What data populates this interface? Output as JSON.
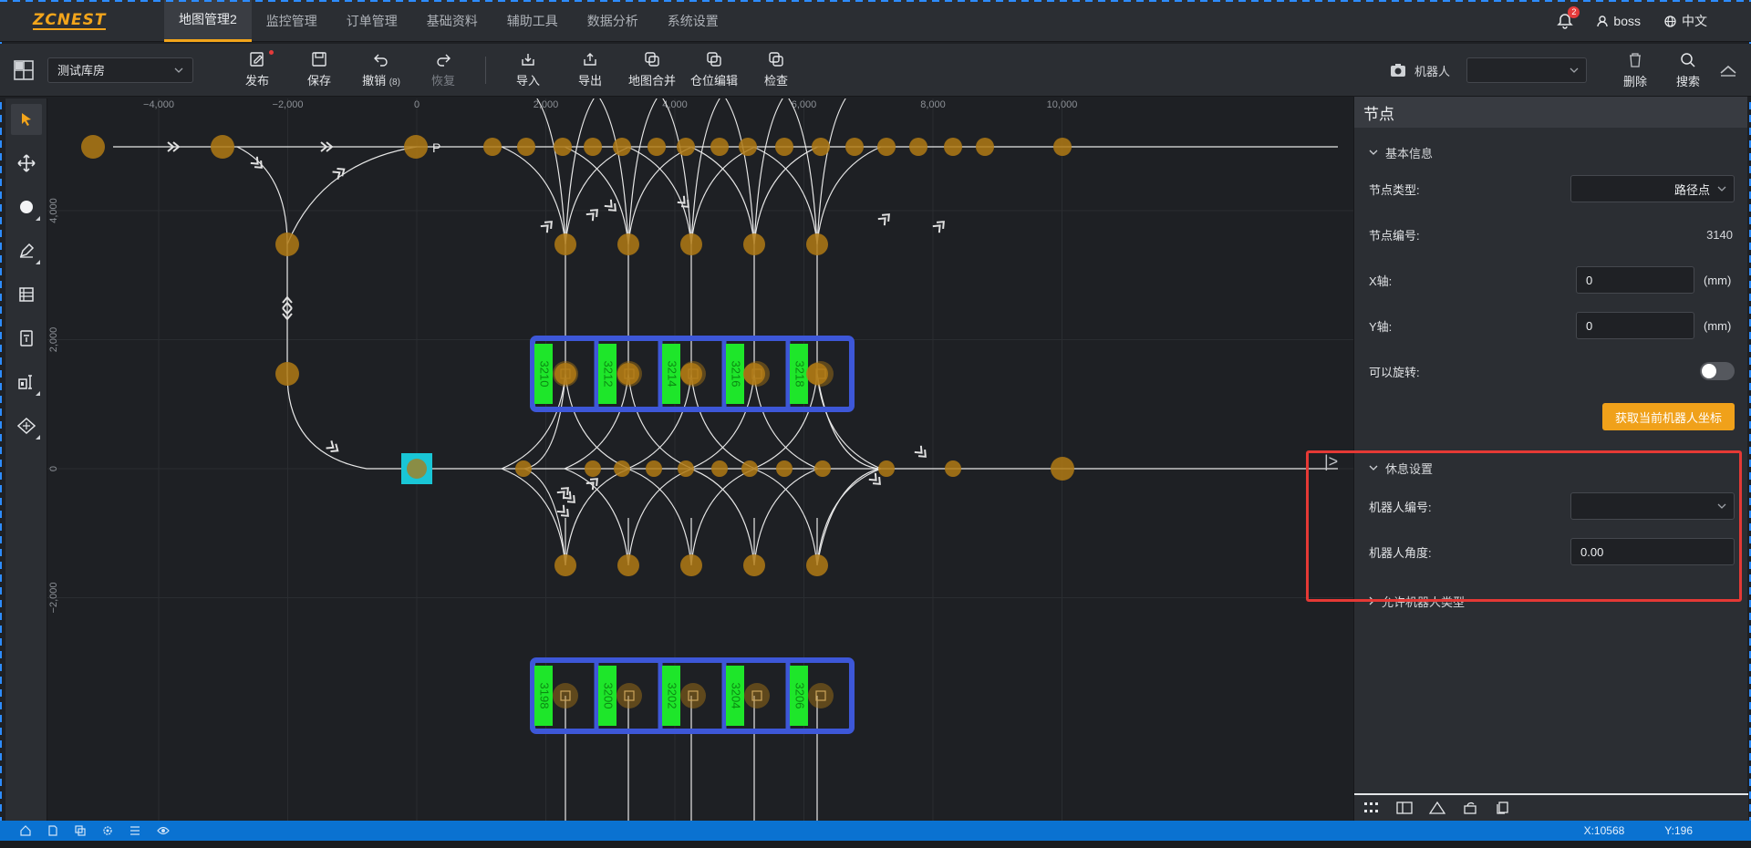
{
  "app": {
    "logo": "ZCNEST"
  },
  "nav": {
    "tabs": [
      "地图管理2",
      "监控管理",
      "订单管理",
      "基础资料",
      "辅助工具",
      "数据分析",
      "系统设置"
    ],
    "notif_count": "2",
    "user": "boss",
    "lang": "中文"
  },
  "toolbar": {
    "warehouse": "测试库房",
    "publish": "发布",
    "save": "保存",
    "undo": "撤销",
    "undo_count": "(8)",
    "redo": "恢复",
    "import": "导入",
    "export": "导出",
    "merge": "地图合并",
    "slot_edit": "仓位编辑",
    "check": "检查",
    "robot_label": "机器人",
    "delete": "删除",
    "search": "搜索"
  },
  "axis": {
    "x_ticks": [
      "−4,000",
      "−2,000",
      "0",
      "2,000",
      "4,000",
      "6,000",
      "8,000",
      "10,000"
    ],
    "y_ticks": [
      "4,000",
      "2,000",
      "0",
      "−2,000"
    ]
  },
  "map": {
    "shelves_top": [
      "3210",
      "3212",
      "3214",
      "3216",
      "3218"
    ],
    "shelves_bottom": [
      "3198",
      "3200",
      "3202",
      "3204",
      "3206"
    ],
    "label_p": "P",
    "colors": {
      "node": "#b07a14",
      "shelf_frame": "#3d57d8",
      "shelf_label": "#1ee62a",
      "selected": "#19c6d6"
    }
  },
  "panel": {
    "title": "节点",
    "basic": {
      "header": "基本信息",
      "node_type_label": "节点类型:",
      "node_type_value": "路径点",
      "node_id_label": "节点编号:",
      "node_id_value": "3140",
      "x_label": "X轴:",
      "x_value": "0",
      "y_label": "Y轴:",
      "y_value": "0",
      "unit": "(mm)",
      "rotate_label": "可以旋转:",
      "get_pos_btn": "获取当前机器人坐标"
    },
    "rest": {
      "header": "休息设置",
      "robot_id_label": "机器人编号:",
      "robot_angle_label": "机器人角度:",
      "robot_angle_value": "0.00"
    },
    "allowed": {
      "header": "允许机器人类型"
    }
  },
  "status": {
    "x": "X:10568",
    "y": "Y:196"
  }
}
